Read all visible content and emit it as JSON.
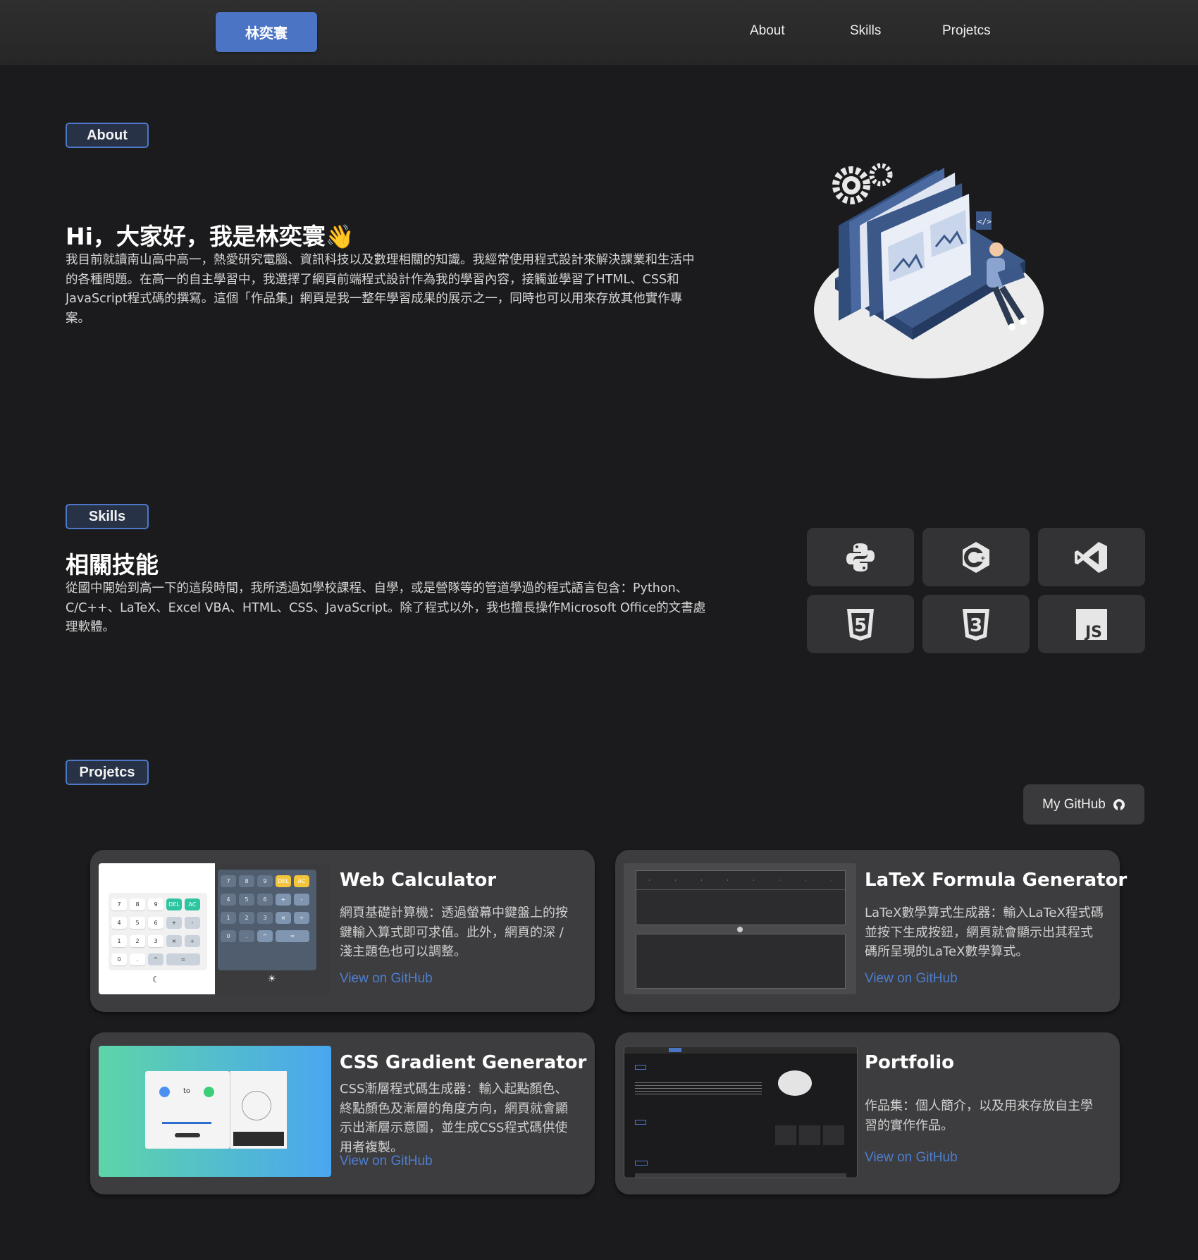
{
  "nav": {
    "brand": "林奕寰",
    "links": [
      "About",
      "Skills",
      "Projetcs"
    ]
  },
  "about": {
    "tag": "About",
    "heading": "Hi，大家好，我是林奕寰👋",
    "paragraph_lines": [
      "我目前就讀南山高中高一，熱愛研究電腦、資訊科技以及數理相關的知識。我經常使用程式設計來解決課業和生活中",
      "的各種問題。在高一的自主學習中，我選擇了網頁前端程式設計作為我的學習內容，接觸並學習了HTML、CSS和",
      "JavaScript程式碼的撰寫。這個「作品集」網頁是我一整年學習成果的展示之一，同時也可以用來存放其他實作專",
      "案。"
    ]
  },
  "skills": {
    "tag": "Skills",
    "heading": "相關技能",
    "paragraph_lines": [
      "從國中開始到高一下的這段時間，我所透過如學校課程、自學，或是營隊等的管道學過的程式語言包含：Python、",
      "C/C++、LaTeX、Excel VBA、HTML、CSS、JavaScript。除了程式以外，我也擅長操作Microsoft Office的文書處",
      "理軟體。"
    ],
    "icons": [
      "python-icon",
      "cpp-icon",
      "vscode-icon",
      "html5-icon",
      "css3-icon",
      "javascript-icon"
    ],
    "icon_html5_glyph": "5",
    "icon_css3_glyph": "3",
    "icon_js_glyph": "JS"
  },
  "projects": {
    "tag": "Projetcs",
    "github_button": "My GitHub",
    "link_label": "View on GitHub",
    "cards": [
      {
        "title": "Web Calculator",
        "desc_lines": [
          "網頁基礎計算機：透過螢幕中鍵盤上的按",
          "鍵輸入算式即可求值。此外，網頁的深 /",
          "淺主題色也可以調整。"
        ]
      },
      {
        "title": "LaTeX Formula Generator",
        "desc_lines": [
          "LaTeX數學算式生成器：輸入LaTeX程式碼",
          "並按下生成按鈕，網頁就會顯示出其程式",
          "碼所呈現的LaTeX數學算式。"
        ]
      },
      {
        "title": "CSS Gradient Generator",
        "desc_lines": [
          "CSS漸層程式碼生成器：輸入起點顏色、",
          "終點顏色及漸層的角度方向，網頁就會顯",
          "示出漸層示意圖，並生成CSS程式碼供使",
          "用者複製。"
        ]
      },
      {
        "title": "Portfolio",
        "desc_lines": [
          "作品集：個人簡介，以及用來存放自主學",
          "習的實作作品。"
        ]
      }
    ]
  },
  "calc_keys": [
    "7",
    "8",
    "9",
    "DEL",
    "AC",
    "4",
    "5",
    "6",
    "+",
    "-",
    "1",
    "2",
    "3",
    "×",
    "÷",
    "0",
    ".",
    "^",
    "="
  ],
  "gradient_thumb": {
    "to_label": "to"
  },
  "colors": {
    "accent": "#4b74c4",
    "link": "#4d7ed0",
    "calc_green": "#2ec4a0",
    "calc_yellow": "#f2c53d"
  }
}
